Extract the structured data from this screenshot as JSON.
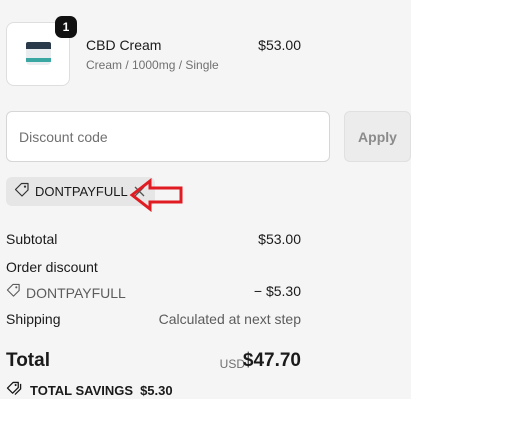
{
  "product": {
    "quantity": "1",
    "name": "CBD Cream",
    "variant": "Cream / 1000mg / Single",
    "price": "$53.00",
    "image_icon": "cream-jar-icon"
  },
  "discount": {
    "placeholder": "Discount code",
    "value": "",
    "apply_label": "Apply",
    "applied_code": "DONTPAYFULL"
  },
  "summary": {
    "subtotal_label": "Subtotal",
    "subtotal_value": "$53.00",
    "order_discount_label": "Order discount",
    "discount_code": "DONTPAYFULL",
    "discount_value": "− $5.30",
    "shipping_label": "Shipping",
    "shipping_value": "Calculated at next step"
  },
  "total": {
    "label": "Total",
    "currency": "USD",
    "value": "$47.70"
  },
  "savings": {
    "label": "TOTAL SAVINGS",
    "value": "$5.30"
  },
  "colors": {
    "panel_bg": "#f5f5f5",
    "annotation_arrow": "#e11b22"
  }
}
